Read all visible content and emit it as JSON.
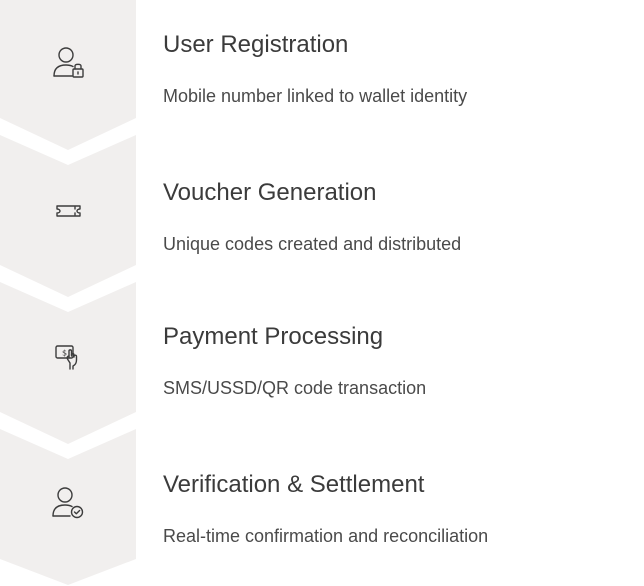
{
  "steps": [
    {
      "title": "User Registration",
      "description": "Mobile number linked to wallet identity",
      "icon": "user-lock-icon"
    },
    {
      "title": "Voucher Generation",
      "description": "Unique codes created and distributed",
      "icon": "ticket-icon"
    },
    {
      "title": "Payment Processing",
      "description": "SMS/USSD/QR code transaction",
      "icon": "hand-payment-icon"
    },
    {
      "title": "Verification & Settlement",
      "description": "Real-time confirmation and reconciliation",
      "icon": "user-check-icon"
    }
  ],
  "colors": {
    "chevron_fill": "#f1efee",
    "icon_stroke": "#3c3c3c",
    "title_text": "#3b3b3b",
    "desc_text": "#4a4a4a"
  }
}
